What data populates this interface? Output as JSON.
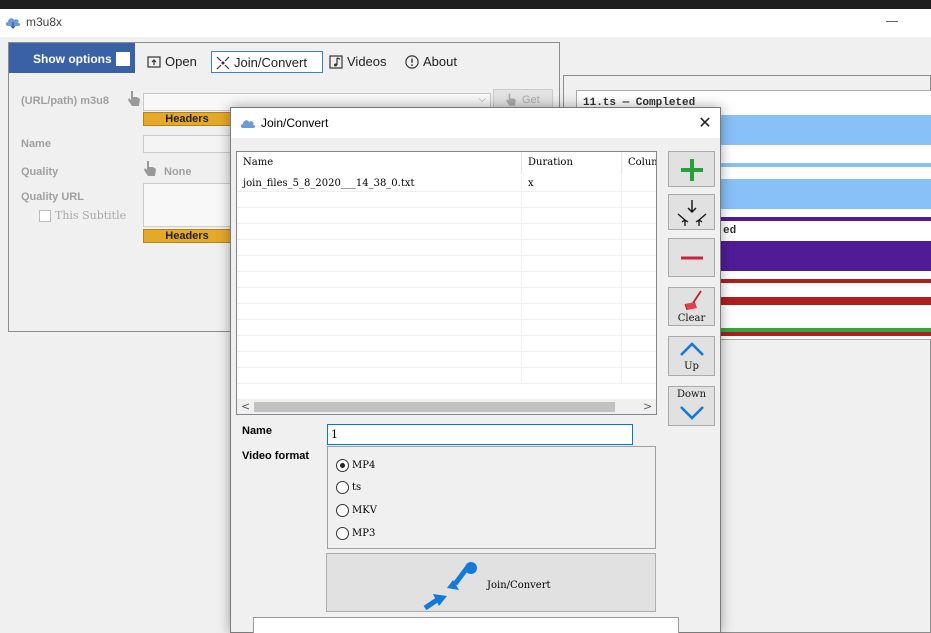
{
  "window": {
    "title": "m3u8x"
  },
  "main": {
    "show_options": "Show options",
    "tabs": [
      {
        "label": "Open"
      },
      {
        "label": "Join/Convert"
      },
      {
        "label": "Videos"
      },
      {
        "label": "About"
      }
    ],
    "url_label": "(URL/path) m3u8",
    "get_label": "Get",
    "headers_label": "Headers",
    "name_label": "Name",
    "quality_label": "Quality",
    "quality_value": "None",
    "quality_url_label": "Quality URL",
    "subtitle_label": "This Subtitle"
  },
  "right_panel": {
    "status_line_1": "11.ts — Completed",
    "status_line_2": "ed",
    "bar_colors": {
      "blue": "#87c1f7",
      "purple": "#4f1c96",
      "red": "#b01e1e",
      "green": "#2eaa3e"
    }
  },
  "dialog": {
    "title": "Join/Convert",
    "columns": [
      "Name",
      "Duration",
      "Colum"
    ],
    "rows": [
      {
        "name": "join_files_5_8_2020___14_38_0.txt",
        "duration": "x",
        "extra": ""
      }
    ],
    "buttons": {
      "add": "",
      "merge": "",
      "remove": "",
      "clear": "Clear",
      "up": "Up",
      "down": "Down"
    },
    "name_label": "Name",
    "name_value": "1",
    "video_format_label": "Video format",
    "formats": [
      {
        "label": "MP4",
        "selected": true
      },
      {
        "label": "ts",
        "selected": false
      },
      {
        "label": "MKV",
        "selected": false
      },
      {
        "label": "MP3",
        "selected": false
      }
    ],
    "join_button": "Join/Convert"
  }
}
